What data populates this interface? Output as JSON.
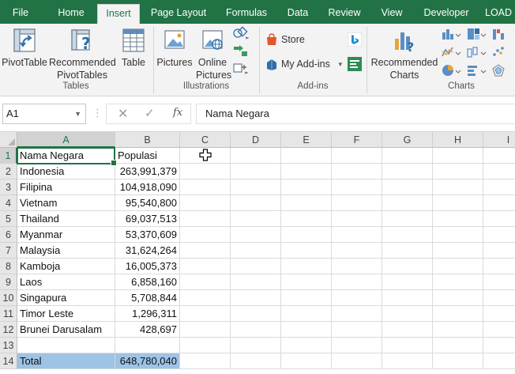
{
  "menu": {
    "tabs": [
      {
        "id": "file",
        "label": "File"
      },
      {
        "id": "home",
        "label": "Home"
      },
      {
        "id": "insert",
        "label": "Insert",
        "active": true
      },
      {
        "id": "page_layout",
        "label": "Page Layout"
      },
      {
        "id": "formulas",
        "label": "Formulas"
      },
      {
        "id": "data",
        "label": "Data"
      },
      {
        "id": "review",
        "label": "Review"
      },
      {
        "id": "view",
        "label": "View"
      },
      {
        "id": "developer",
        "label": "Developer"
      },
      {
        "id": "load",
        "label": "LOAD"
      }
    ]
  },
  "ribbon": {
    "tables": {
      "group_label": "Tables",
      "pivottable": "PivotTable",
      "recommended_line1": "Recommended",
      "recommended_line2": "PivotTables",
      "table": "Table"
    },
    "illustrations": {
      "group_label": "Illustrations",
      "pictures": "Pictures",
      "online_line1": "Online",
      "online_line2": "Pictures"
    },
    "addins": {
      "group_label": "Add-ins",
      "store": "Store",
      "my_addins": "My Add-ins"
    },
    "charts": {
      "group_label": "Charts",
      "recommended_line1": "Recommended",
      "recommended_line2": "Charts"
    }
  },
  "formula_bar": {
    "name_box": "A1",
    "fx_label": "fx",
    "content": "Nama Negara"
  },
  "sheet": {
    "columns": [
      "A",
      "B",
      "C",
      "D",
      "E",
      "F",
      "G",
      "H",
      "I"
    ],
    "rows": [
      {
        "n": "1",
        "a": "Nama Negara",
        "b": "Populasi"
      },
      {
        "n": "2",
        "a": "Indonesia",
        "b": "263,991,379"
      },
      {
        "n": "3",
        "a": "Filipina",
        "b": "104,918,090"
      },
      {
        "n": "4",
        "a": "Vietnam",
        "b": "95,540,800"
      },
      {
        "n": "5",
        "a": "Thailand",
        "b": "69,037,513"
      },
      {
        "n": "6",
        "a": "Myanmar",
        "b": "53,370,609"
      },
      {
        "n": "7",
        "a": "Malaysia",
        "b": "31,624,264"
      },
      {
        "n": "8",
        "a": "Kamboja",
        "b": "16,005,373"
      },
      {
        "n": "9",
        "a": "Laos",
        "b": "6,858,160"
      },
      {
        "n": "10",
        "a": "Singapura",
        "b": "5,708,844"
      },
      {
        "n": "11",
        "a": "Timor Leste",
        "b": "1,296,311"
      },
      {
        "n": "12",
        "a": "Brunei Darusalam",
        "b": "428,697"
      },
      {
        "n": "13",
        "a": "",
        "b": ""
      },
      {
        "n": "14",
        "a": "Total",
        "b": "648,780,040"
      }
    ]
  },
  "colors": {
    "accent": "#217346",
    "highlight": "#9dc3e6"
  }
}
